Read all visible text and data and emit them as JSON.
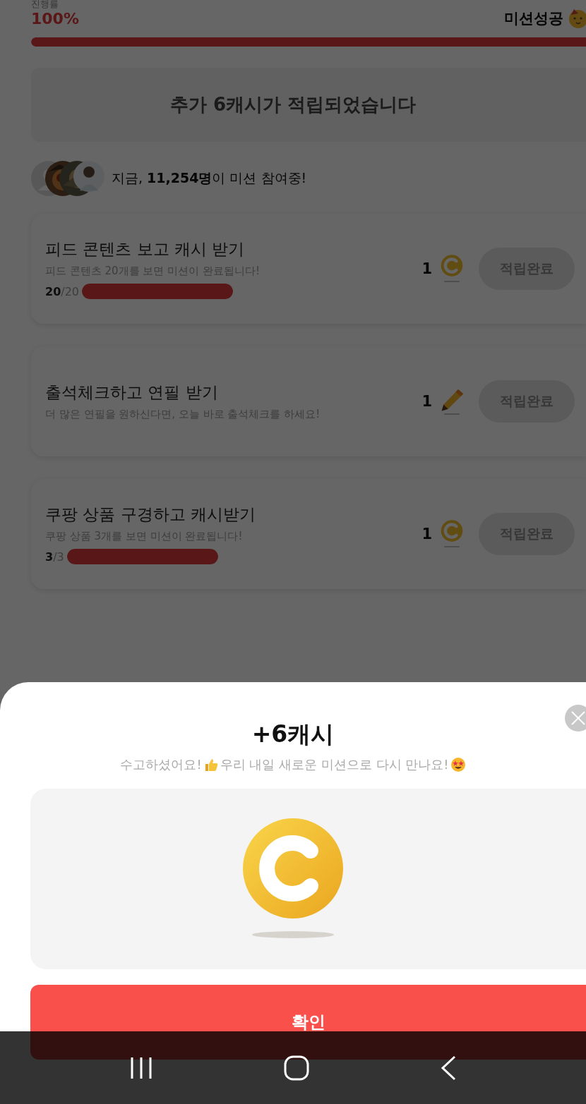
{
  "progress": {
    "label": "진행률",
    "percent": "100%",
    "status": "미션성공",
    "level": 1
  },
  "banner": "추가 6캐시가 적립되었습니다",
  "participants": {
    "text": "지금, **11,254명**이 미션 참여중!"
  },
  "missions": [
    {
      "title": "피드 콘텐츠 보고 캐시 받기",
      "desc": "피드 콘텐츠 20개를 보면 미션이 완료됩니다!",
      "done": "20",
      "total": "/20",
      "level": 1,
      "reward": "1",
      "kind": "coin",
      "button": "적립완료",
      "disabled": true
    },
    {
      "title": "출석체크하고 연필 받기",
      "desc": "더 많은 연필을 원하신다면, 오늘 바로 출석체크를 하세요!",
      "reward": "1",
      "kind": "pencil",
      "button": "적립완료",
      "disabled": true
    },
    {
      "title": "쿠팡 상품 구경하고 캐시받기",
      "desc": "쿠팡 상품 3개를 보면 미션이 완료됩니다!",
      "done": "3",
      "total": "/3",
      "level": 1,
      "reward": "1",
      "kind": "coin",
      "button": "적립완료",
      "disabled": true
    }
  ],
  "sheet": {
    "title": "+6캐시",
    "message_1": "수고하셨어요!",
    "message_2": "우리 내일 새로운 미션으로 다시 만나요!",
    "confirm": "확인"
  }
}
